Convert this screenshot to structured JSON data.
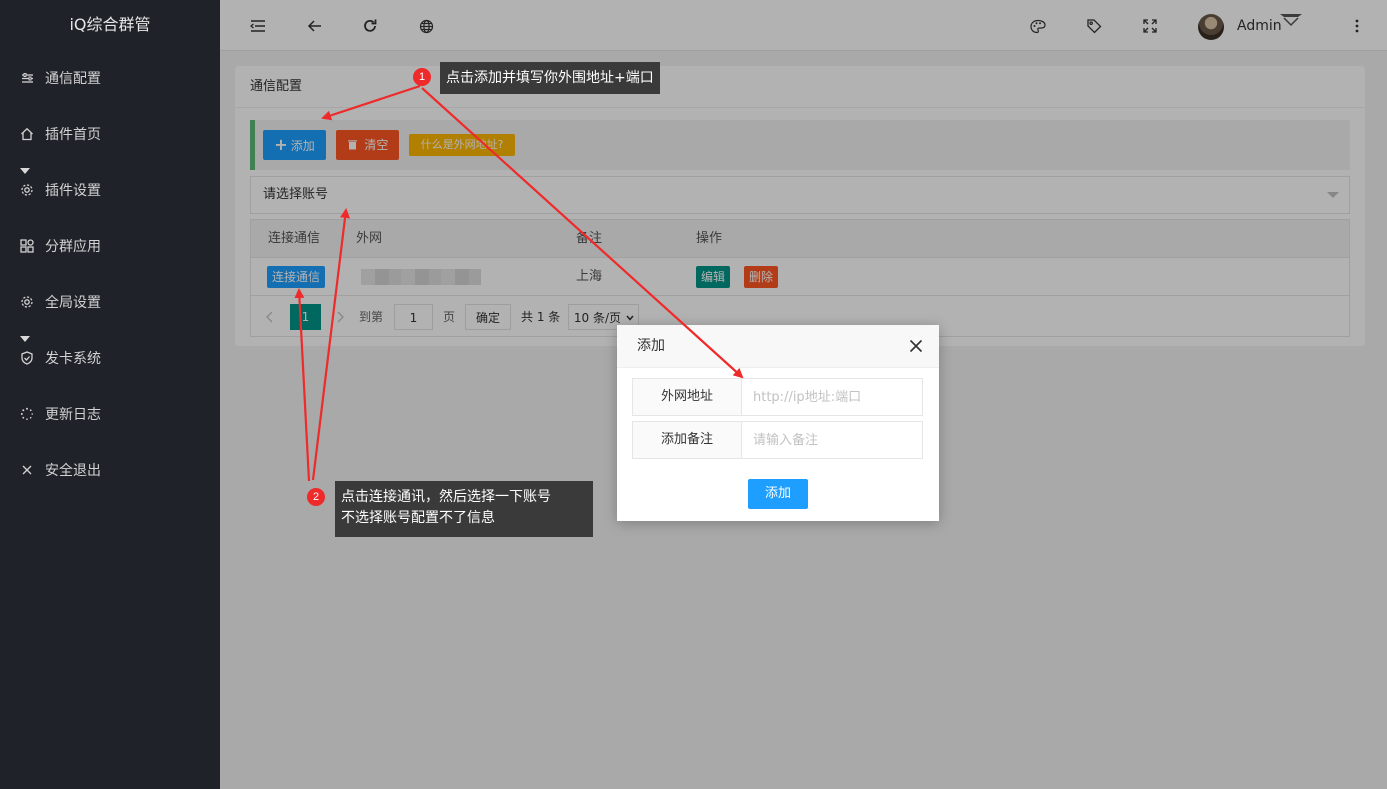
{
  "app": {
    "title": "iQ综合群管"
  },
  "sidebar": {
    "items": [
      {
        "label": "通信配置",
        "icon": "sliders-icon",
        "expandable": false
      },
      {
        "label": "插件首页",
        "icon": "home-icon",
        "expandable": false
      },
      {
        "label": "插件设置",
        "icon": "gear-icon",
        "expandable": true
      },
      {
        "label": "分群应用",
        "icon": "apps-icon",
        "expandable": false
      },
      {
        "label": "全局设置",
        "icon": "gear-icon",
        "expandable": false
      },
      {
        "label": "发卡系统",
        "icon": "shield-icon",
        "expandable": true
      },
      {
        "label": "更新日志",
        "icon": "loading-icon",
        "expandable": false
      },
      {
        "label": "安全退出",
        "icon": "close-icon",
        "expandable": false
      }
    ]
  },
  "header": {
    "user_name": "Admin",
    "icons": [
      "menu-toggle-icon",
      "back-arrow-icon",
      "refresh-icon",
      "globe-icon",
      "palette-icon",
      "tag-icon",
      "fullscreen-icon",
      "more-vertical-icon"
    ]
  },
  "card": {
    "title": "通信配置",
    "toolbar": {
      "add_label": "添加",
      "clear_label": "清空",
      "help_label": "什么是外网地址?"
    },
    "account_select": {
      "value": "请选择账号"
    },
    "table": {
      "columns": [
        "连接通信",
        "外网",
        "备注",
        "操作"
      ],
      "rows": [
        {
          "connect_label": "连接通信",
          "external": "",
          "remark": "上海",
          "edit_label": "编辑",
          "delete_label": "删除"
        }
      ]
    },
    "pager": {
      "current_page": "1",
      "goto_prefix": "到第",
      "goto_value": "1",
      "goto_suffix": "页",
      "confirm_label": "确定",
      "total_label": "共 1 条",
      "page_size_label": "10 条/页"
    }
  },
  "modal": {
    "title": "添加",
    "fields": [
      {
        "label": "外网地址",
        "placeholder": "http://ip地址:端口"
      },
      {
        "label": "添加备注",
        "placeholder": "请输入备注"
      }
    ],
    "submit_label": "添加"
  },
  "annotations": [
    {
      "number": "1",
      "text": "点击添加并填写你外围地址+端口"
    },
    {
      "number": "2",
      "line1": "点击连接通讯，然后选择一下账号",
      "line2": "不选择账号配置不了信息"
    }
  ],
  "colors": {
    "sidebar_bg": "#20222a",
    "primary_blue": "#1e9fff",
    "danger_orange": "#ff5722",
    "warn_yellow": "#ffb800",
    "teal": "#009688",
    "toolbar_accent": "#5fb878",
    "annotation_red": "#ee2a2a"
  }
}
